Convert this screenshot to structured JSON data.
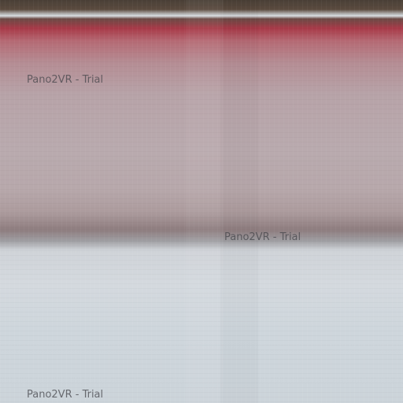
{
  "viewer": {
    "watermarks": [
      "Pano2VR - Trial",
      "Pano2VR - Trial",
      "Pano2VR - Trial"
    ]
  }
}
